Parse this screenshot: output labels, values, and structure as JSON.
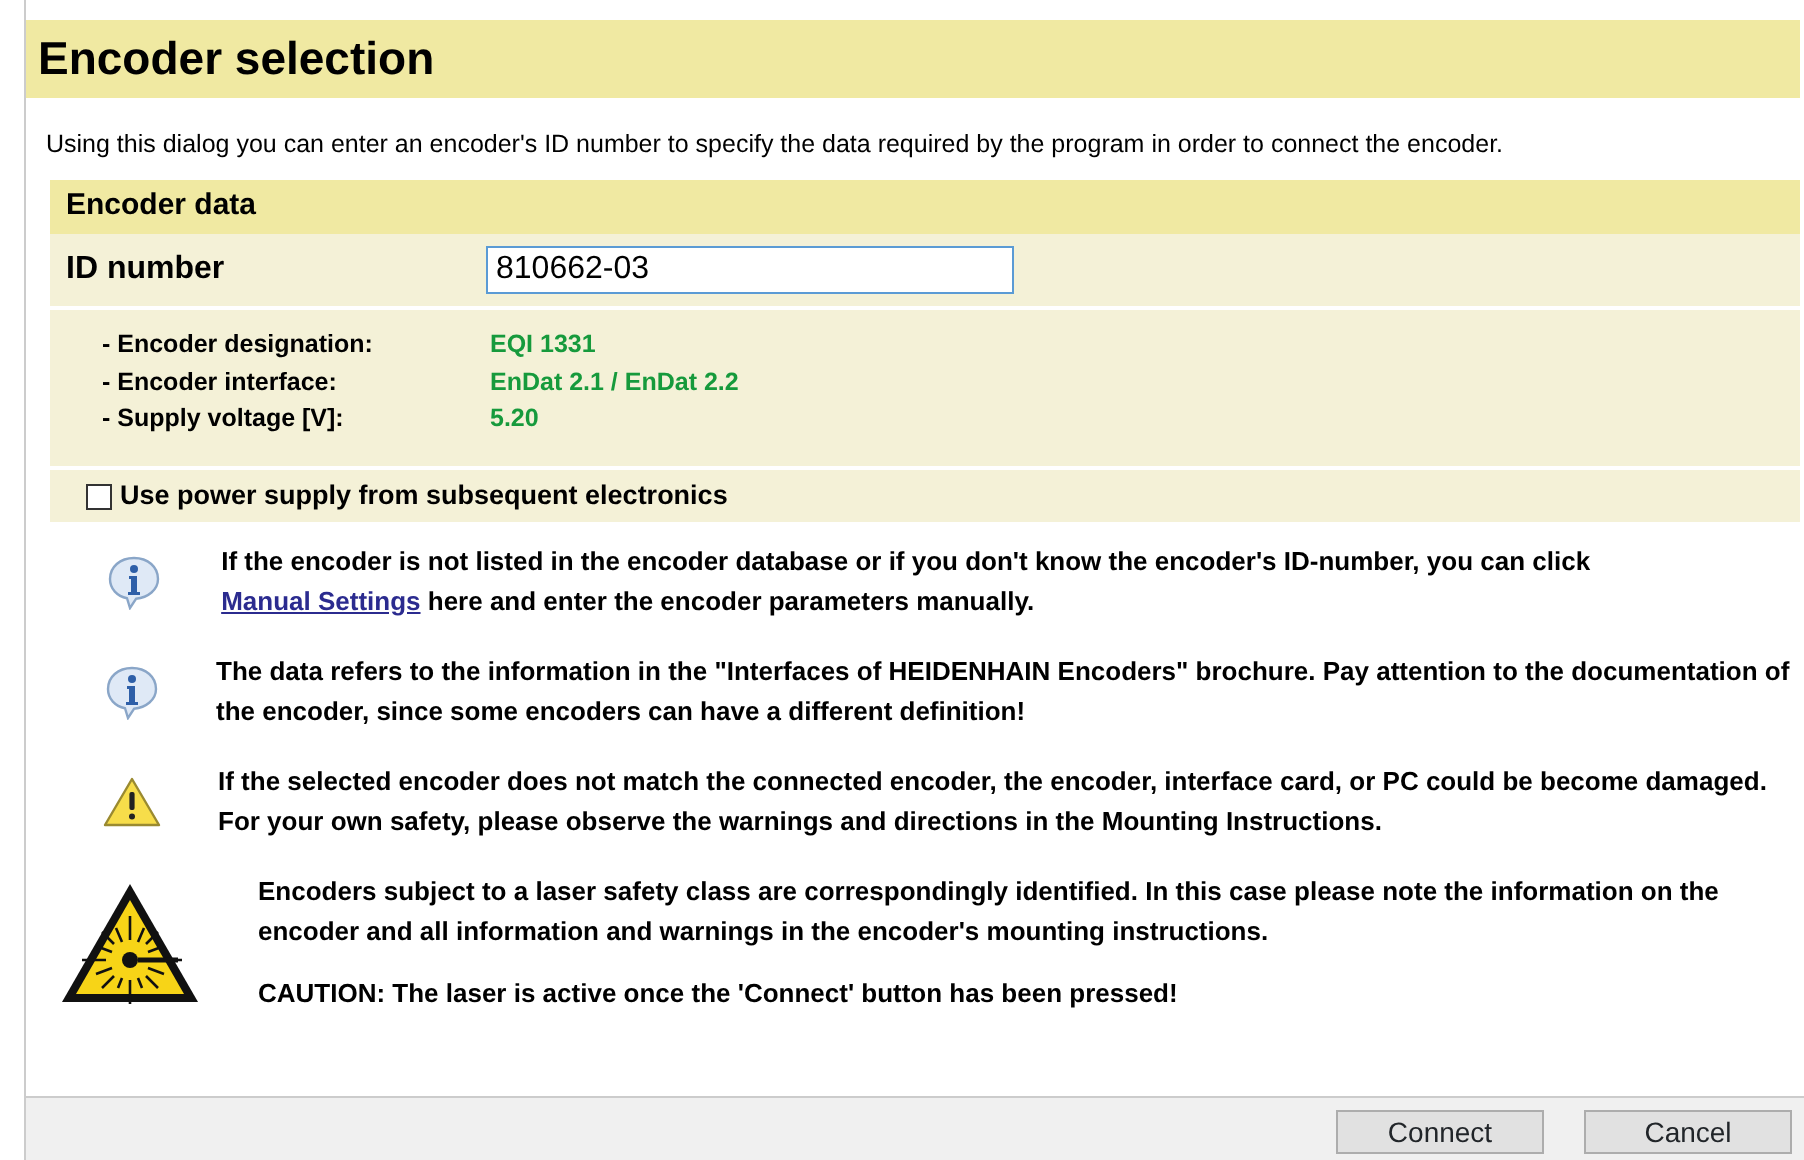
{
  "title": "Encoder selection",
  "intro": "Using this dialog you can enter an encoder's ID number to specify the data required by the program in order to connect the encoder.",
  "encoder_data": {
    "heading": "Encoder data",
    "id_label": "ID number",
    "id_value": "810662-03",
    "details": [
      {
        "label": "- Encoder designation:",
        "value": "EQI 1331"
      },
      {
        "label": "- Encoder interface:",
        "value": "EnDat 2.1 / EnDat 2.2"
      },
      {
        "label": "- Supply voltage [V]:",
        "value": "5.20"
      }
    ],
    "power_supply": {
      "label": "Use power supply from subsequent electronics",
      "checked": false
    }
  },
  "notes": [
    {
      "kind": "info",
      "paragraphs": [
        {
          "text": "If the encoder is not listed in the encoder database or if you don't know the encoder's ID-number, you can click ",
          "link": "Manual Settings",
          "after": " here and enter the encoder parameters manually."
        }
      ]
    },
    {
      "kind": "info",
      "paragraphs": [
        {
          "text": "The data refers to the information in the \"Interfaces of HEIDENHAIN Encoders\" brochure. Pay attention to the documentation of the encoder, since some encoders can have a different definition!"
        }
      ]
    },
    {
      "kind": "warning",
      "paragraphs": [
        {
          "text": "If the selected encoder does not match the connected encoder, the encoder, interface card, or PC could be become damaged. For your own safety, please observe the warnings and directions in the Mounting Instructions."
        }
      ]
    },
    {
      "kind": "laser",
      "paragraphs": [
        {
          "text": "Encoders subject to a laser safety class are correspondingly identified. In this case please note the information on the encoder and all information and warnings in the encoder's mounting instructions."
        },
        {
          "text": "CAUTION: The laser is active once the 'Connect' button has been pressed!"
        }
      ]
    }
  ],
  "buttons": [
    "Connect",
    "Cancel"
  ]
}
